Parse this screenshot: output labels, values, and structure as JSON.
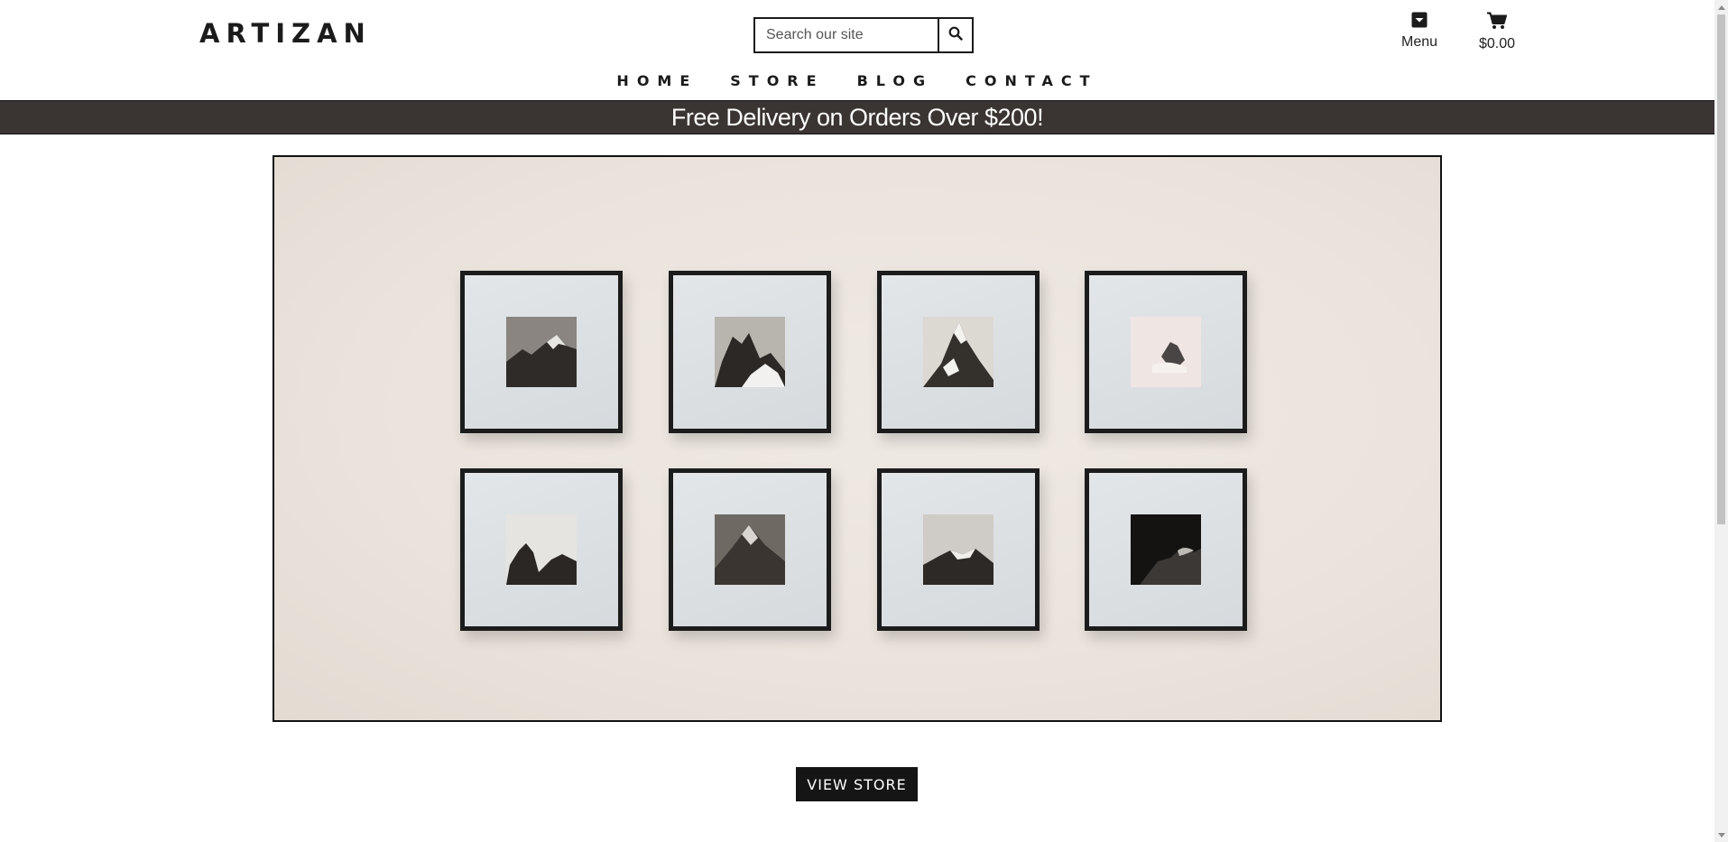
{
  "header": {
    "logo": "ARTIZAN",
    "search_placeholder": "Search our site",
    "menu_label": "Menu",
    "cart_total": "$0.00"
  },
  "nav": {
    "items": [
      "HOME",
      "STORE",
      "BLOG",
      "CONTACT"
    ]
  },
  "banner": {
    "text": "Free Delivery on Orders Over $200!"
  },
  "hero": {
    "alt": "Eight framed mountain photographs on a wall"
  },
  "cta": {
    "label": "VIEW STORE"
  },
  "colors": {
    "banner_bg": "#3a3532",
    "button_bg": "#151515",
    "text": "#1b1b1b"
  },
  "icons": {
    "search": "search-icon",
    "menu": "chevron-down-box-icon",
    "cart": "cart-icon"
  }
}
